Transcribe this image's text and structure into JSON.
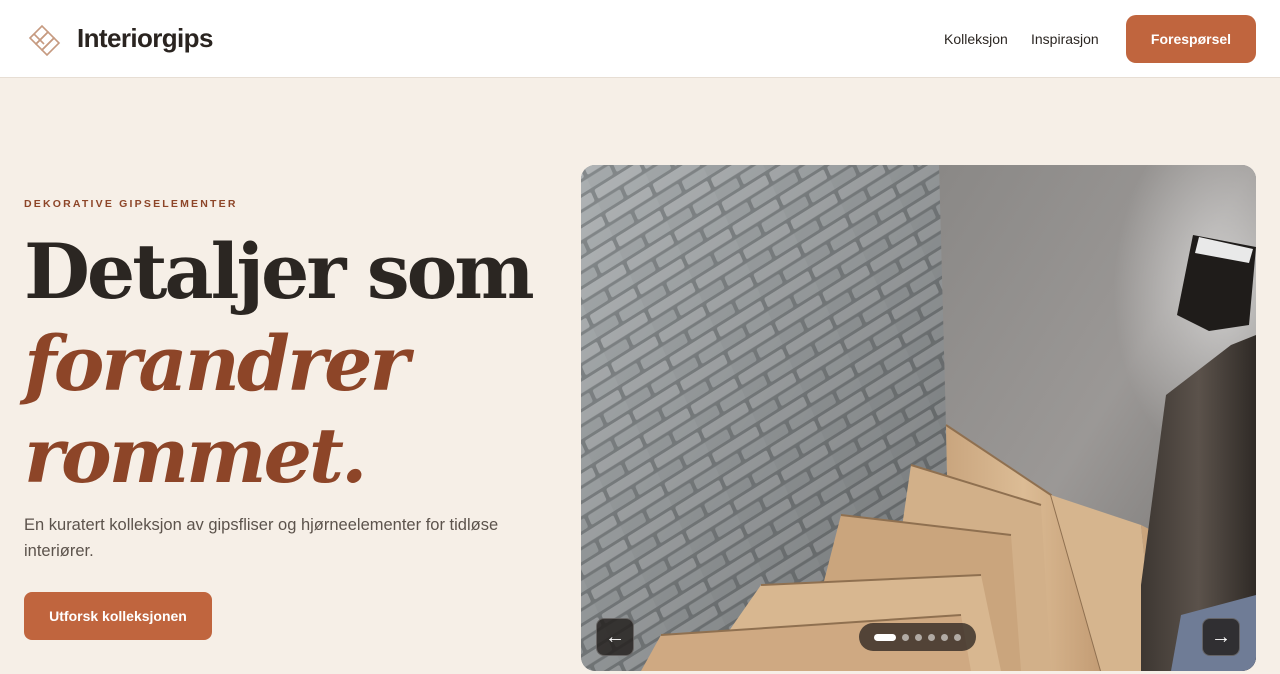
{
  "header": {
    "brand": "Interiorgips",
    "logo_icon": "interlocking-tile-logo",
    "nav": [
      {
        "label": "Kolleksjon"
      },
      {
        "label": "Inspirasjon"
      }
    ],
    "cta_label": "Forespørsel"
  },
  "hero": {
    "eyebrow": "DEKORATIVE GIPSELEMENTER",
    "title_line1": "Detaljer som",
    "title_line2": "forandrer",
    "title_line3": "rommet.",
    "lead": "En kuratert kolleksjon av gipsfliser og hjørneelementer for tidløse interiører.",
    "cta_label": "Utforsk kolleksjonen"
  },
  "carousel": {
    "prev_icon": "←",
    "next_icon": "→",
    "slide_count": 6,
    "active_index": 0
  },
  "colors": {
    "accent": "#c0653e",
    "accent_dark": "#8d4528",
    "background": "#f6efe7",
    "text": "#2b2622"
  }
}
